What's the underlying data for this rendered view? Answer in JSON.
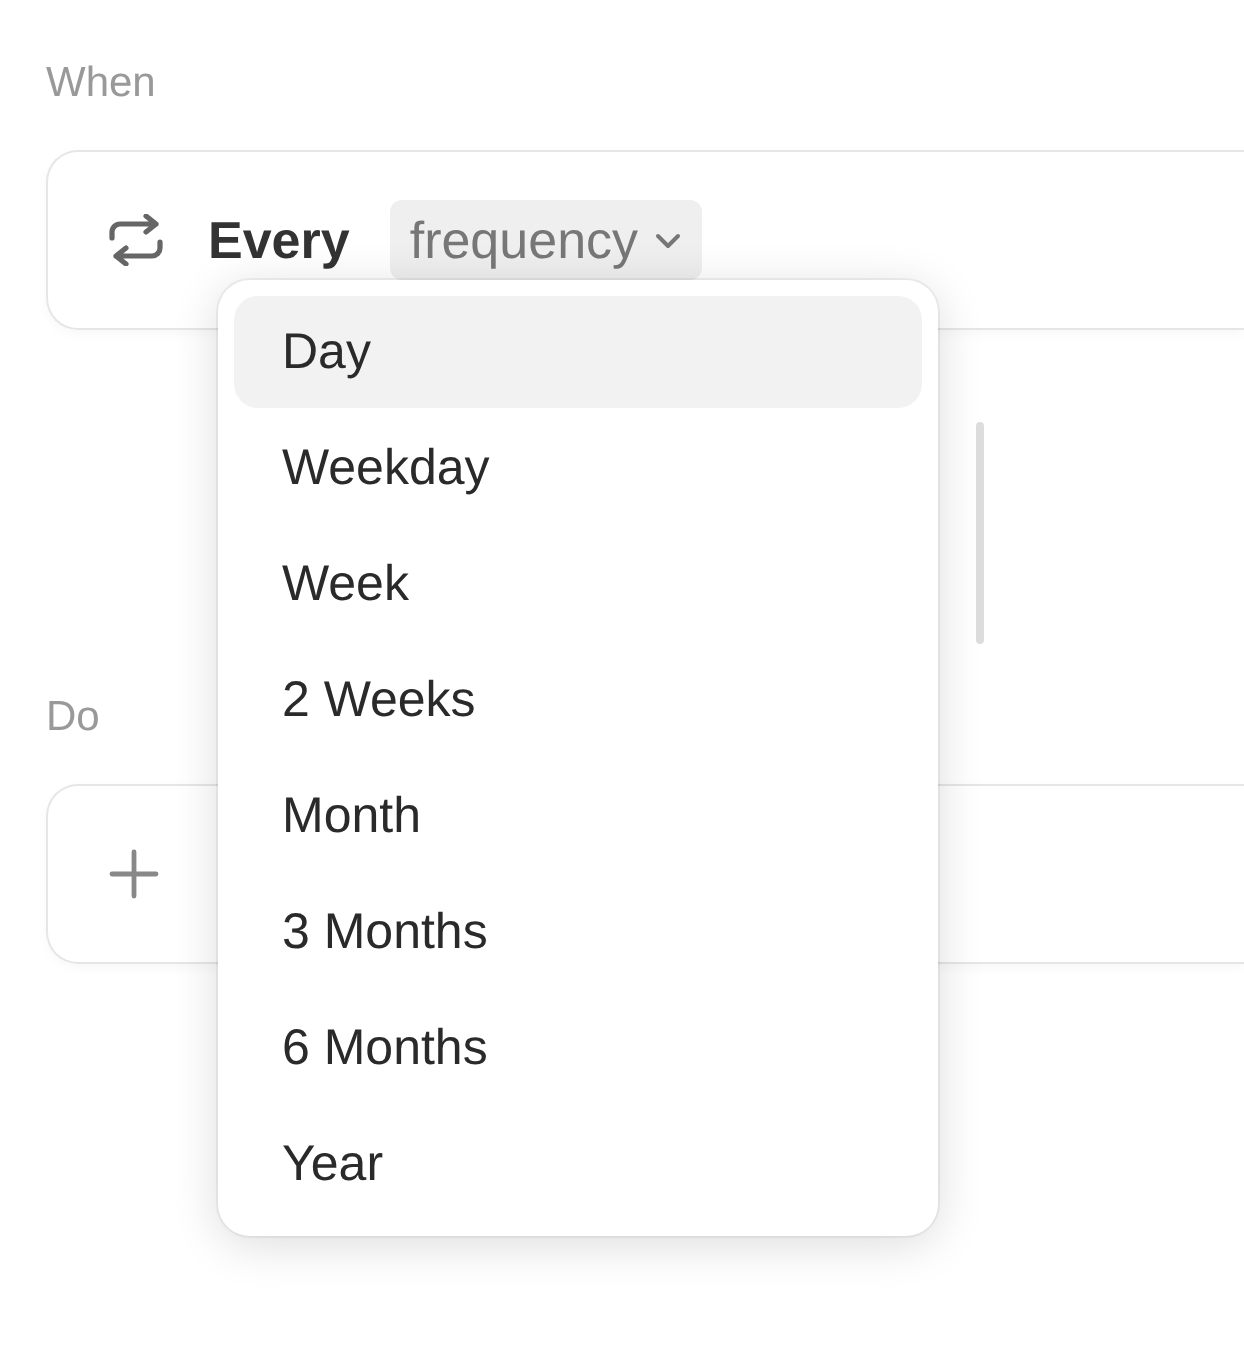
{
  "when": {
    "label": "When",
    "prefix": "Every",
    "frequency": "frequency"
  },
  "menu": {
    "items": [
      {
        "label": "Day",
        "selected": true
      },
      {
        "label": "Weekday",
        "selected": false
      },
      {
        "label": "Week",
        "selected": false
      },
      {
        "label": "2 Weeks",
        "selected": false
      },
      {
        "label": "Month",
        "selected": false
      },
      {
        "label": "3 Months",
        "selected": false
      },
      {
        "label": "6 Months",
        "selected": false
      },
      {
        "label": "Year",
        "selected": false
      }
    ]
  },
  "do": {
    "label": "Do"
  }
}
